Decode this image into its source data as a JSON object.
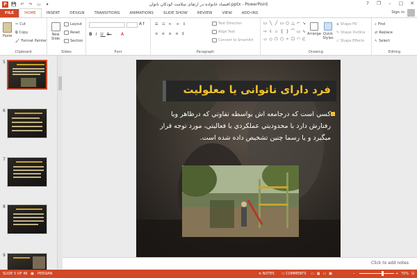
{
  "window": {
    "title": "اقتصاد خانواده در ارتقای سلامت کودکان ناتوان.pptx - PowerPoint",
    "controls": [
      "?",
      "❐",
      "–",
      "□",
      "✕"
    ]
  },
  "quick_access": {
    "logo": "P",
    "save": "💾",
    "undo": "↶",
    "redo": "↷",
    "start": "▭",
    "more": "▾"
  },
  "tabs": [
    "FILE",
    "HOME",
    "INSERT",
    "DESIGN",
    "TRANSITIONS",
    "ANIMATIONS",
    "SLIDE SHOW",
    "REVIEW",
    "VIEW",
    "ADD-INS"
  ],
  "active_tab": "HOME",
  "account": {
    "sign_in": "Sign in"
  },
  "ribbon": {
    "clipboard": {
      "paste": "Paste",
      "cut": "Cut",
      "copy": "Copy",
      "format_painter": "Format Painter",
      "label": "Clipboard"
    },
    "slides": {
      "new_slide": "New Slide",
      "layout": "Layout",
      "reset": "Reset",
      "section": "Section",
      "label": "Slides"
    },
    "font": {
      "label": "Font"
    },
    "paragraph": {
      "text_direction": "Text Direction",
      "align_text": "Align Text",
      "convert_smartart": "Convert to SmartArt",
      "label": "Paragraph"
    },
    "drawing": {
      "arrange": "Arrange",
      "quick_styles": "Quick Styles",
      "shape_fill": "Shape Fill",
      "shape_outline": "Shape Outline",
      "shape_effects": "Shape Effects",
      "label": "Drawing",
      "shapes": [
        "▭",
        "╲",
        "╱",
        "▭",
        "○",
        "△",
        "⌐",
        "↘",
        "⇨",
        "⇩",
        "☆",
        "{",
        "}",
        "⌒",
        "▭",
        "∿",
        "▱",
        "◇",
        "⬠",
        "⬡",
        "⚬",
        "☐",
        "◠",
        "⊏"
      ]
    },
    "editing": {
      "find": "Find",
      "replace": "Replace",
      "select": "Select",
      "label": "Editing"
    }
  },
  "thumbnails": [
    {
      "number": "5",
      "selected": true
    },
    {
      "number": "6",
      "selected": false
    },
    {
      "number": "7",
      "selected": false
    },
    {
      "number": "8",
      "selected": false
    },
    {
      "number": "9",
      "selected": false
    }
  ],
  "slide": {
    "title": "فرد دارای ناتوانی یا معلولیت",
    "body": "کسي است که درجامعه اش بواسطه تفاوتي که درظاهر ويا رفتارش دارد با محدوديتي عملکردي يا فعاليتي، مورد توجه قرار ميگيرد و يا رسما چنين تشخيص داده شده است."
  },
  "notes": {
    "placeholder": "Click to add notes"
  },
  "status": {
    "slide_indicator": "SLIDE 5 OF 46",
    "language": "PERSIAN",
    "notes": "NOTES",
    "comments": "COMMENTS",
    "zoom": "70%",
    "zoom_fraction": 0.65
  },
  "colors": {
    "accent": "#d24726",
    "title_yellow": "#f2c230"
  }
}
